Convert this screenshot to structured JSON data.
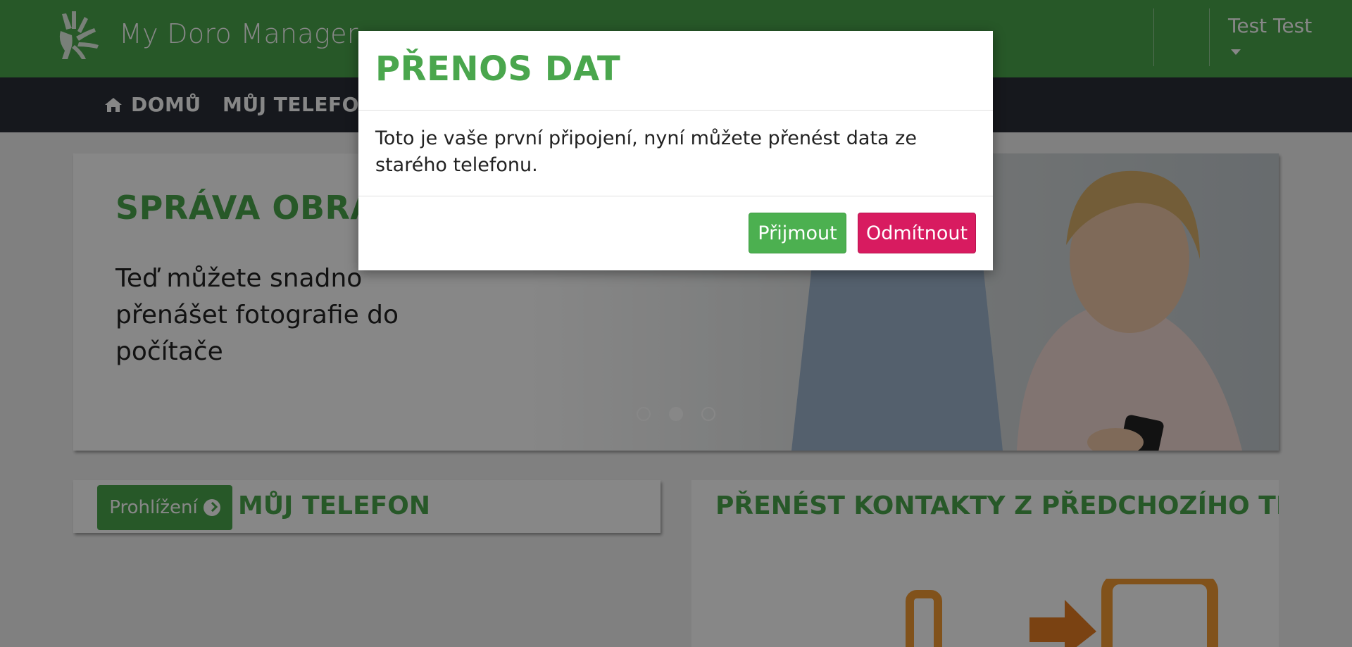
{
  "header": {
    "app_title": "My Doro Manager",
    "user_name": "Test Test",
    "brand_color": "#4aa64d"
  },
  "nav": {
    "items": [
      {
        "label": "DOMŮ",
        "icon": "home-icon"
      },
      {
        "label": "MŮJ TELEFON"
      }
    ],
    "background": "#2a2f38"
  },
  "hero": {
    "title": "SPRÁVA OBRÁZKŮ",
    "text": "Teď můžete snadno přenášet fotografie do počítače",
    "carousel": {
      "total": 3,
      "active_index": 1
    }
  },
  "cards": {
    "my_phone": {
      "browse_label": "Prohlížení",
      "title": "MŮJ TELEFON"
    },
    "transfer": {
      "title": "PŘENÉST KONTAKTY Z PŘEDCHOZÍHO TELEFONU"
    }
  },
  "modal": {
    "title": "PŘENOS DAT",
    "body": "Toto je vaše první připojení, nyní můžete přenést data ze starého telefonu.",
    "accept_label": "Přijmout",
    "decline_label": "Odmítnout",
    "accept_color": "#4cb050",
    "decline_color": "#d81b60"
  }
}
